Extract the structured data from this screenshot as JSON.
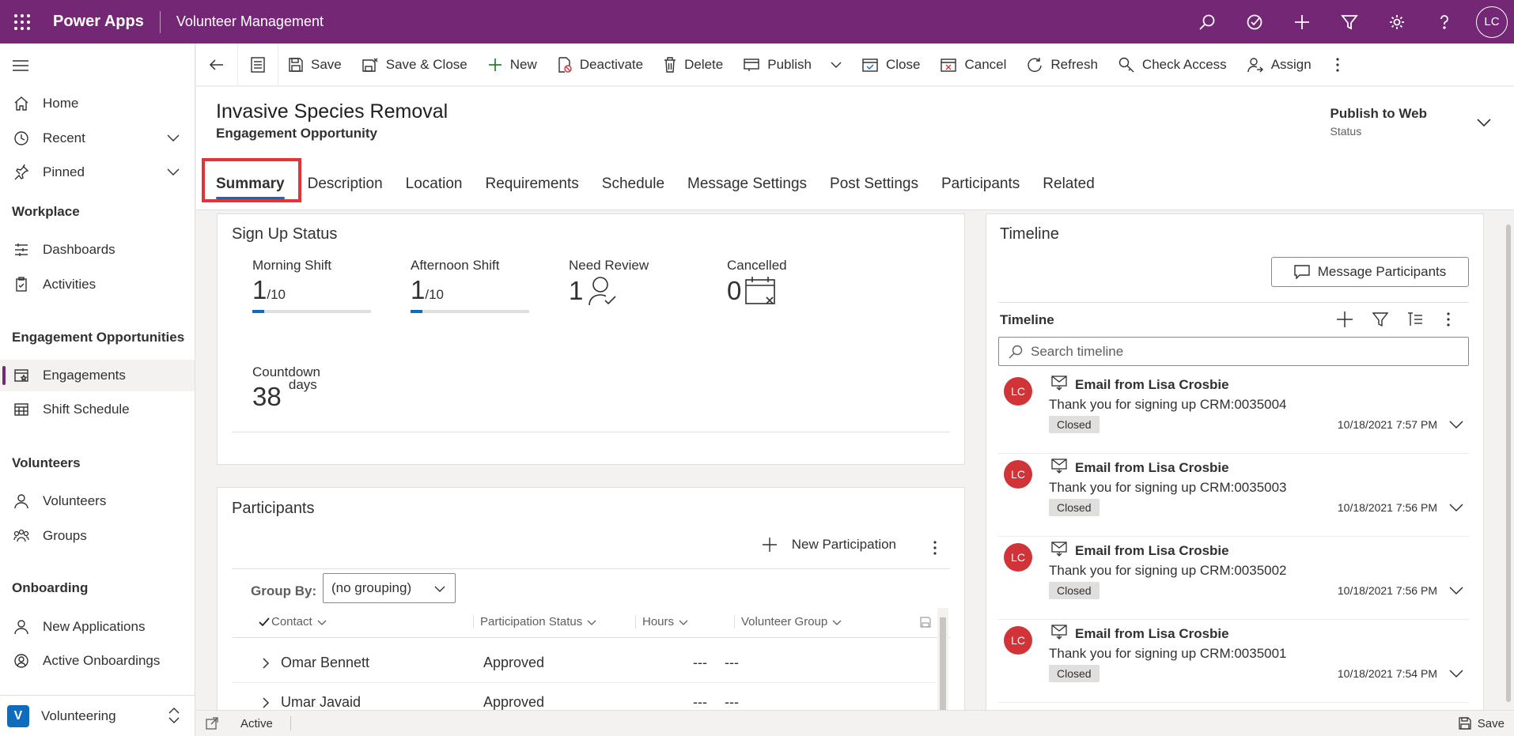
{
  "topbar": {
    "brand": "Power Apps",
    "app_title": "Volunteer Management",
    "avatar_initials": "LC",
    "bg_color": "#742774"
  },
  "sidebar": {
    "items_top": [
      {
        "label": "Home"
      },
      {
        "label": "Recent"
      },
      {
        "label": "Pinned"
      }
    ],
    "groups": [
      {
        "title": "Workplace",
        "items": [
          {
            "label": "Dashboards"
          },
          {
            "label": "Activities"
          }
        ]
      },
      {
        "title": "Engagement Opportunities",
        "items": [
          {
            "label": "Engagements"
          },
          {
            "label": "Shift Schedule"
          }
        ]
      },
      {
        "title": "Volunteers",
        "items": [
          {
            "label": "Volunteers"
          },
          {
            "label": "Groups"
          }
        ]
      },
      {
        "title": "Onboarding",
        "items": [
          {
            "label": "New Applications"
          },
          {
            "label": "Active Onboardings"
          }
        ]
      }
    ],
    "app_switcher": {
      "letter": "V",
      "label": "Volunteering"
    }
  },
  "commands": {
    "save": "Save",
    "save_close": "Save & Close",
    "new": "New",
    "deactivate": "Deactivate",
    "delete": "Delete",
    "publish": "Publish",
    "close": "Close",
    "cancel": "Cancel",
    "refresh": "Refresh",
    "check_access": "Check Access",
    "assign": "Assign"
  },
  "record": {
    "title": "Invasive Species Removal",
    "entity": "Engagement Opportunity",
    "bpf_stage": "Publish to Web",
    "bpf_sub": "Status"
  },
  "tabs": [
    "Summary",
    "Description",
    "Location",
    "Requirements",
    "Schedule",
    "Message Settings",
    "Post Settings",
    "Participants",
    "Related"
  ],
  "signup": {
    "title": "Sign Up Status",
    "morning": {
      "label": "Morning Shift",
      "value": "1",
      "max": "/10",
      "fill": 0.1
    },
    "afternoon": {
      "label": "Afternoon Shift",
      "value": "1",
      "max": "/10",
      "fill": 0.1
    },
    "review": {
      "label": "Need Review",
      "value": "1"
    },
    "cancelled": {
      "label": "Cancelled",
      "value": "0"
    },
    "countdown": {
      "label": "Countdown",
      "value": "38",
      "unit": "days"
    }
  },
  "participants": {
    "title": "Participants",
    "new_btn": "New Participation",
    "group_by_label": "Group By:",
    "group_by_value": "(no grouping)",
    "columns": [
      "Contact",
      "Participation Status",
      "Hours",
      "Volunteer Group"
    ],
    "rows": [
      {
        "contact": "Omar Bennett",
        "status": "Approved",
        "hours": "---",
        "group": "---"
      },
      {
        "contact": "Umar Javaid",
        "status": "Approved",
        "hours": "---",
        "group": "---"
      }
    ]
  },
  "timeline": {
    "card_title": "Timeline",
    "message_btn": "Message Participants",
    "header": "Timeline",
    "search_placeholder": "Search timeline",
    "items": [
      {
        "initials": "LC",
        "title": "Email from Lisa Crosbie",
        "body": "Thank you for signing up CRM:0035004",
        "badge": "Closed",
        "date": "10/18/2021 7:57 PM"
      },
      {
        "initials": "LC",
        "title": "Email from Lisa Crosbie",
        "body": "Thank you for signing up CRM:0035003",
        "badge": "Closed",
        "date": "10/18/2021 7:56 PM"
      },
      {
        "initials": "LC",
        "title": "Email from Lisa Crosbie",
        "body": "Thank you for signing up CRM:0035002",
        "badge": "Closed",
        "date": "10/18/2021 7:56 PM"
      },
      {
        "initials": "LC",
        "title": "Email from Lisa Crosbie",
        "body": "Thank you for signing up CRM:0035001",
        "badge": "Closed",
        "date": "10/18/2021 7:54 PM"
      }
    ]
  },
  "statusbar": {
    "state": "Active",
    "save": "Save"
  }
}
